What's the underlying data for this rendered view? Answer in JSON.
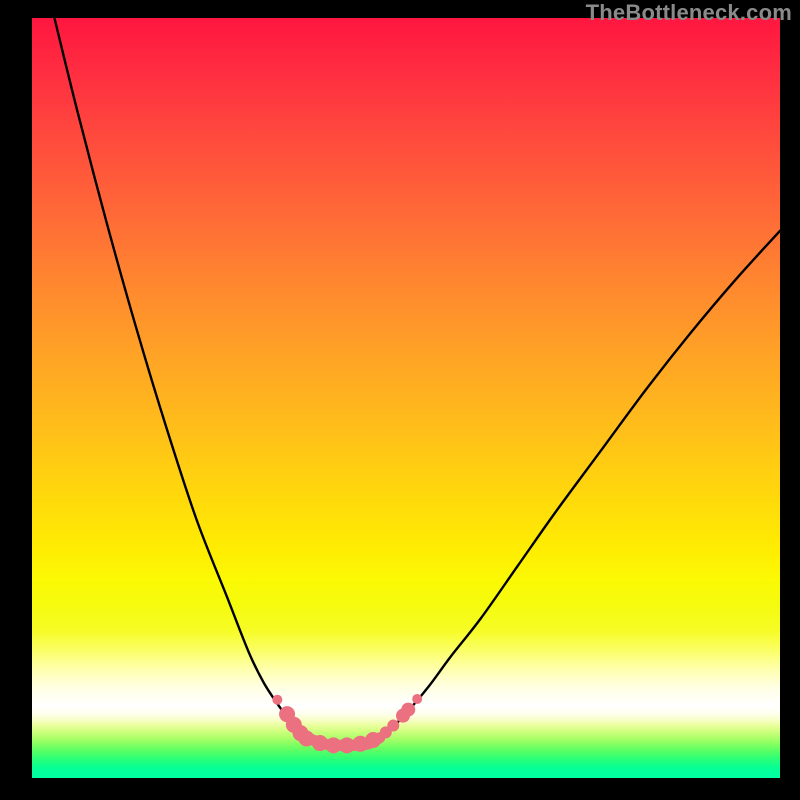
{
  "watermark": {
    "text": "TheBottleneck.com"
  },
  "chart_data": {
    "type": "line",
    "title": "",
    "xlabel": "",
    "ylabel": "",
    "xlim": [
      0,
      100
    ],
    "ylim": [
      0,
      100
    ],
    "grid": false,
    "legend": false,
    "series": [
      {
        "name": "left-branch",
        "color": "#000000",
        "x": [
          3,
          6,
          10,
          14,
          18,
          22,
          26,
          29,
          31,
          33,
          34.5,
          35.8,
          36.8
        ],
        "y": [
          100,
          88,
          73,
          59,
          46,
          34,
          24,
          16.5,
          12.5,
          9.5,
          7.5,
          6.2,
          5.3
        ]
      },
      {
        "name": "right-branch",
        "color": "#000000",
        "x": [
          46.5,
          48,
          50,
          53,
          56,
          60,
          65,
          70,
          76,
          82,
          88,
          94,
          100
        ],
        "y": [
          5.3,
          6.5,
          8.5,
          12,
          16,
          21,
          28,
          35,
          43,
          51,
          58.5,
          65.5,
          72
        ]
      },
      {
        "name": "flat-bottom",
        "color": "#eb7080",
        "x": [
          36.8,
          39,
          41,
          43,
          45,
          46.5
        ],
        "y": [
          5.3,
          4.5,
          4.3,
          4.3,
          4.5,
          5.3
        ]
      }
    ],
    "points": {
      "name": "markers",
      "color": "#eb7080",
      "items": [
        {
          "x": 32.8,
          "y": 10.3,
          "r": 5
        },
        {
          "x": 34.1,
          "y": 8.4,
          "r": 8
        },
        {
          "x": 35.0,
          "y": 7.0,
          "r": 8
        },
        {
          "x": 35.9,
          "y": 5.9,
          "r": 8
        },
        {
          "x": 36.7,
          "y": 5.2,
          "r": 8
        },
        {
          "x": 38.5,
          "y": 4.6,
          "r": 8
        },
        {
          "x": 40.3,
          "y": 4.3,
          "r": 8
        },
        {
          "x": 42.1,
          "y": 4.3,
          "r": 8
        },
        {
          "x": 43.9,
          "y": 4.5,
          "r": 8
        },
        {
          "x": 45.6,
          "y": 5.0,
          "r": 8
        },
        {
          "x": 47.3,
          "y": 6.0,
          "r": 6
        },
        {
          "x": 48.3,
          "y": 6.9,
          "r": 6
        },
        {
          "x": 49.6,
          "y": 8.2,
          "r": 7
        },
        {
          "x": 50.3,
          "y": 9.0,
          "r": 7
        },
        {
          "x": 51.5,
          "y": 10.4,
          "r": 5
        }
      ]
    },
    "gradient_stops": [
      {
        "pos": 0,
        "color": "#ff163f"
      },
      {
        "pos": 50,
        "color": "#ffb020"
      },
      {
        "pos": 75,
        "color": "#f6f90a"
      },
      {
        "pos": 90,
        "color": "#ffffff"
      },
      {
        "pos": 100,
        "color": "#00ffa1"
      }
    ]
  }
}
